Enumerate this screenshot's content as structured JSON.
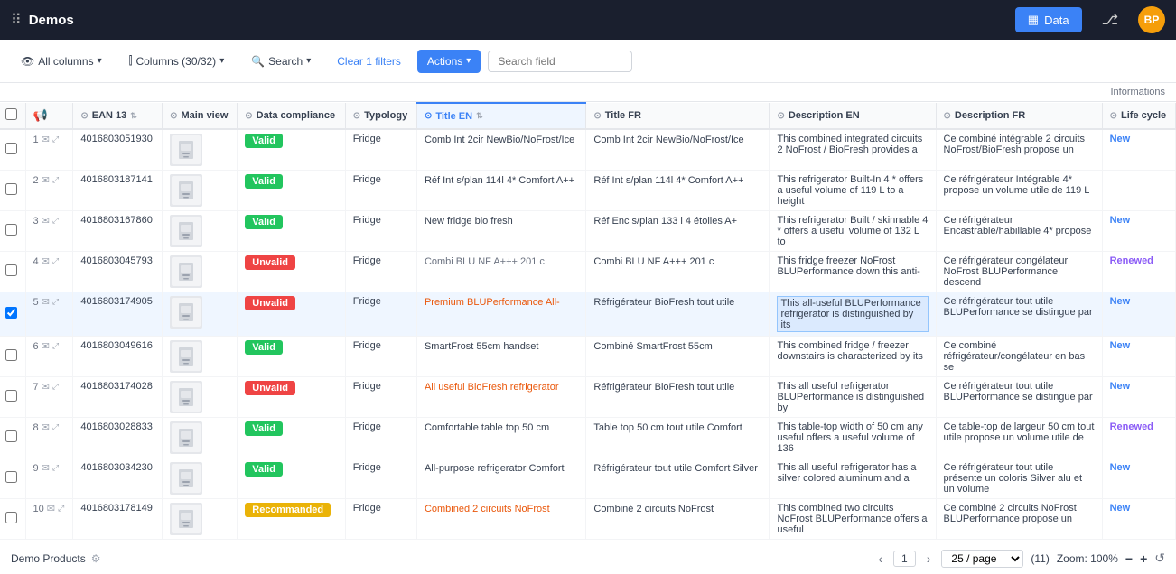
{
  "nav": {
    "app_name": "Demos",
    "buttons": [
      {
        "label": "Data",
        "active": true,
        "icon": "table-icon"
      },
      {
        "label": "",
        "active": false,
        "icon": "org-icon"
      }
    ],
    "avatar": "BP"
  },
  "toolbar": {
    "all_columns_label": "All columns",
    "columns_label": "Columns (30/32)",
    "search_label": "Search",
    "clear_filters_label": "Clear 1 filters",
    "actions_label": "Actions",
    "search_field_placeholder": "Search field"
  },
  "info_header": "Informations",
  "columns": [
    {
      "key": "check",
      "label": "",
      "type": "check"
    },
    {
      "key": "announce",
      "label": "",
      "type": "announce"
    },
    {
      "key": "ean13",
      "label": "EAN 13"
    },
    {
      "key": "main_view",
      "label": "Main view"
    },
    {
      "key": "data_compliance",
      "label": "Data compliance"
    },
    {
      "key": "typology",
      "label": "Typology"
    },
    {
      "key": "title_en",
      "label": "Title EN",
      "highlight": true
    },
    {
      "key": "title_fr",
      "label": "Title FR"
    },
    {
      "key": "desc_en",
      "label": "Description EN"
    },
    {
      "key": "desc_fr",
      "label": "Description FR"
    },
    {
      "key": "lifecycle",
      "label": "Life cycle"
    }
  ],
  "rows": [
    {
      "num": "1",
      "ean13": "4016803051930",
      "has_thumb": true,
      "compliance": "Valid",
      "compliance_type": "green",
      "typology": "Fridge",
      "title_en": "Comb Int 2cir NewBio/NoFrost/Ice",
      "title_en_style": "normal",
      "title_fr": "Comb Int 2cir NewBio/NoFrost/Ice",
      "desc_en": "This combined integrated circuits 2 NoFrost / BioFresh provides a",
      "desc_fr": "Ce combiné intégrable 2 circuits NoFrost/BioFresh propose un",
      "lifecycle": "New",
      "lifecycle_type": "new"
    },
    {
      "num": "2",
      "ean13": "4016803187141",
      "has_thumb": true,
      "compliance": "Valid",
      "compliance_type": "green",
      "typology": "Fridge",
      "title_en": "Réf Int s/plan 114l 4* Comfort A++",
      "title_en_style": "normal",
      "title_fr": "Réf Int s/plan 114l 4* Comfort A++",
      "desc_en": "This refrigerator Built-In 4 * offers a useful volume of 119 L to a height",
      "desc_fr": "Ce réfrigérateur Intégrable 4* propose un volume utile de 119 L",
      "lifecycle": "",
      "lifecycle_type": ""
    },
    {
      "num": "3",
      "ean13": "4016803167860",
      "has_thumb": true,
      "compliance": "Valid",
      "compliance_type": "green",
      "typology": "Fridge",
      "title_en": "New fridge bio fresh",
      "title_en_style": "normal",
      "title_fr": "Réf Enc s/plan 133 l 4 étoiles A+",
      "desc_en": "This refrigerator Built / skinnable 4 * offers a useful volume of 132 L to",
      "desc_fr": "Ce réfrigérateur Encastrable/habillable 4* propose",
      "lifecycle": "New",
      "lifecycle_type": "new"
    },
    {
      "num": "4",
      "ean13": "4016803045793",
      "has_thumb": true,
      "compliance": "Unvalid",
      "compliance_type": "red",
      "typology": "Fridge",
      "title_en": "Combi BLU NF A+++ 201 c",
      "title_en_style": "red",
      "title_fr": "Combi BLU NF A+++ 201 c",
      "desc_en": "This fridge freezer NoFrost BLUPerformance down this anti-",
      "desc_fr": "Ce réfrigérateur congélateur NoFrost BLUPerformance descend",
      "lifecycle": "Renewed",
      "lifecycle_type": "renewed"
    },
    {
      "num": "5",
      "ean13": "4016803174905",
      "has_thumb": true,
      "compliance": "Unvalid",
      "compliance_type": "red",
      "typology": "Fridge",
      "title_en": "Premium BLUPerformance All-",
      "title_en_style": "orange",
      "title_fr": "Réfrigérateur BioFresh tout utile",
      "desc_en": "This all-useful BLUPerformance refrigerator is distinguished by its",
      "desc_en_highlight": true,
      "desc_fr": "Ce réfrigérateur tout utile BLUPerformance se distingue par",
      "lifecycle": "New",
      "lifecycle_type": "new"
    },
    {
      "num": "6",
      "ean13": "4016803049616",
      "has_thumb": true,
      "compliance": "Valid",
      "compliance_type": "green",
      "typology": "Fridge",
      "title_en": "SmartFrost 55cm handset",
      "title_en_style": "normal",
      "title_fr": "Combiné SmartFrost 55cm",
      "desc_en": "This combined fridge / freezer downstairs is characterized by its",
      "desc_fr": "Ce combiné réfrigérateur/congélateur en bas se",
      "lifecycle": "New",
      "lifecycle_type": "new"
    },
    {
      "num": "7",
      "ean13": "4016803174028",
      "has_thumb": true,
      "compliance": "Unvalid",
      "compliance_type": "red",
      "typology": "Fridge",
      "title_en": "All useful BioFresh refrigerator",
      "title_en_style": "orange",
      "title_fr": "Réfrigérateur BioFresh tout utile",
      "desc_en": "This all useful refrigerator BLUPerformance is distinguished by",
      "desc_fr": "Ce réfrigérateur tout utile BLUPerformance se distingue par",
      "lifecycle": "New",
      "lifecycle_type": "new"
    },
    {
      "num": "8",
      "ean13": "4016803028833",
      "has_thumb": true,
      "compliance": "Valid",
      "compliance_type": "green",
      "typology": "Fridge",
      "title_en": "Comfortable table top 50 cm",
      "title_en_style": "normal",
      "title_fr": "Table top 50 cm tout utile Comfort",
      "desc_en": "This table-top width of 50 cm any useful offers a useful volume of 136",
      "desc_fr": "Ce table-top de largeur 50 cm tout utile propose un volume utile de",
      "lifecycle": "Renewed",
      "lifecycle_type": "renewed"
    },
    {
      "num": "9",
      "ean13": "4016803034230",
      "has_thumb": true,
      "compliance": "Valid",
      "compliance_type": "green",
      "typology": "Fridge",
      "title_en": "All-purpose refrigerator Comfort",
      "title_en_style": "normal",
      "title_fr": "Réfrigérateur tout utile Comfort Silver",
      "desc_en": "This all useful refrigerator has a silver colored aluminum and a",
      "desc_fr": "Ce réfrigérateur tout utile présente un coloris Silver alu et un volume",
      "lifecycle": "New",
      "lifecycle_type": "new"
    },
    {
      "num": "10",
      "ean13": "4016803178149",
      "has_thumb": true,
      "compliance": "Recommanded",
      "compliance_type": "yellow",
      "typology": "Fridge",
      "title_en": "Combined 2 circuits NoFrost",
      "title_en_style": "orange",
      "title_fr": "Combiné 2 circuits NoFrost",
      "desc_en": "This combined two circuits NoFrost BLUPerformance offers a useful",
      "desc_fr": "Ce combiné 2 circuits NoFrost BLUPerformance propose un",
      "lifecycle": "New",
      "lifecycle_type": "new"
    }
  ],
  "footer": {
    "tab_label": "Demo Products",
    "pagination": {
      "current_page": "1",
      "per_page": "25 / page",
      "total": "(11)",
      "zoom": "Zoom: 100%"
    }
  }
}
